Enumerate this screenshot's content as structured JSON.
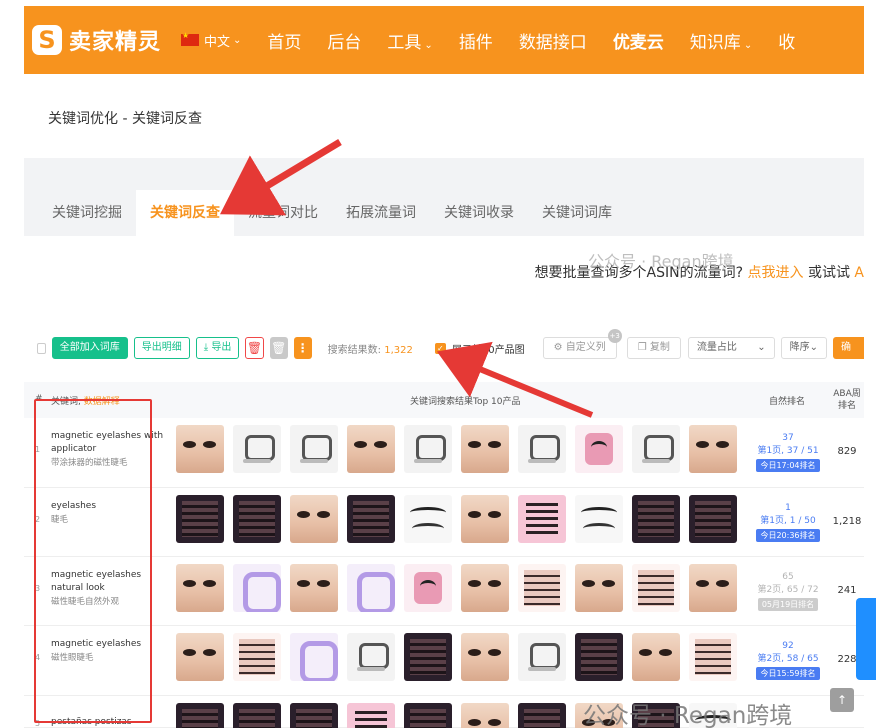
{
  "header": {
    "brand": "卖家精灵",
    "logo_letter": "S",
    "lang": "中文",
    "nav": [
      {
        "label": "首页",
        "has_caret": false
      },
      {
        "label": "后台",
        "has_caret": false
      },
      {
        "label": "工具",
        "has_caret": true
      },
      {
        "label": "插件",
        "has_caret": false
      },
      {
        "label": "数据接口",
        "has_caret": false
      },
      {
        "label": "优麦云",
        "has_caret": false
      },
      {
        "label": "知识库",
        "has_caret": true
      },
      {
        "label": "收",
        "has_caret": false
      }
    ],
    "accent_color": "#f7931e"
  },
  "page": {
    "title": "关键词优化 - 关键词反查",
    "tabs": [
      "关键词挖掘",
      "关键词反查",
      "流量词对比",
      "拓展流量词",
      "关键词收录",
      "关键词词库"
    ],
    "active_tab": "关键词反查",
    "promo_text": "想要批量查询多个ASIN的流量词?",
    "promo_link": "点我进入",
    "promo_tail": "或试试",
    "promo_extra": "A",
    "watermark_small": "公众号 · Regan跨境",
    "watermark_big": "公众号 · Regan跨境"
  },
  "toolbar": {
    "add_all": "全部加入词库",
    "export_detail": "导出明细",
    "export": "导出",
    "result_label": "搜索结果数:",
    "result_count": "1,322",
    "show_top10": "展示前10产品图",
    "custom_cols": "自定义列",
    "custom_badge": "+3",
    "copy": "复制",
    "sort_field": "流量占比",
    "sort_order": "降序",
    "confirm": "确定"
  },
  "table": {
    "headers": {
      "index": "#",
      "keyword": "关键词",
      "keyword_hint": "数据解释",
      "top10": "关键词搜索结果Top 10产品",
      "natural_rank": "自然排名",
      "aba": "ABA周排名"
    },
    "rows": [
      {
        "idx": "1",
        "keyword": "magnetic eyelashes with applicator",
        "keyword_cn": "带涂抹器的磁性睫毛",
        "rank": "37",
        "rank_page": "第1页, 37 / 51",
        "rank_time": "今日17:04排名",
        "rank_dim": false,
        "aba": "829",
        "thumbs": [
          "face",
          "case",
          "case",
          "face",
          "case",
          "face",
          "case",
          "pink-case",
          "case",
          "face"
        ]
      },
      {
        "idx": "2",
        "keyword": "eyelashes",
        "keyword_cn": "睫毛",
        "rank": "1",
        "rank_page": "第1页, 1 / 50",
        "rank_time": "今日20:36排名",
        "rank_dim": false,
        "aba": "1,218",
        "thumbs": [
          "box-dark",
          "box-dark",
          "face",
          "box-dark",
          "lash",
          "face",
          "box-pink",
          "lash",
          "box-dark",
          "box-dark"
        ]
      },
      {
        "idx": "3",
        "keyword": "magnetic eyelashes natural look",
        "keyword_cn": "磁性睫毛自然外观",
        "rank": "65",
        "rank_page": "第2页, 65 / 72",
        "rank_time": "05月19日排名",
        "rank_dim": true,
        "aba": "241",
        "thumbs": [
          "face",
          "purple",
          "face",
          "purple",
          "pink-case",
          "face",
          "stack",
          "face",
          "stack",
          "face"
        ]
      },
      {
        "idx": "4",
        "keyword": "magnetic eyelashes",
        "keyword_cn": "磁性眼睫毛",
        "rank": "92",
        "rank_page": "第2页, 58 / 65",
        "rank_time": "今日15:59排名",
        "rank_dim": false,
        "aba": "228",
        "thumbs": [
          "face",
          "stack",
          "purple",
          "case",
          "box-dark",
          "face",
          "case",
          "box-dark",
          "face",
          "stack"
        ]
      },
      {
        "idx": "5",
        "keyword": "pestañas postizas naturales",
        "keyword_cn": "",
        "rank": "",
        "rank_page": "",
        "rank_time": "",
        "rank_dim": false,
        "aba": "",
        "thumbs": [
          "box-dark",
          "box-dark",
          "box-dark",
          "box-pink",
          "box-dark",
          "face",
          "box-dark",
          "face",
          "box-dark",
          "lash"
        ]
      }
    ]
  }
}
